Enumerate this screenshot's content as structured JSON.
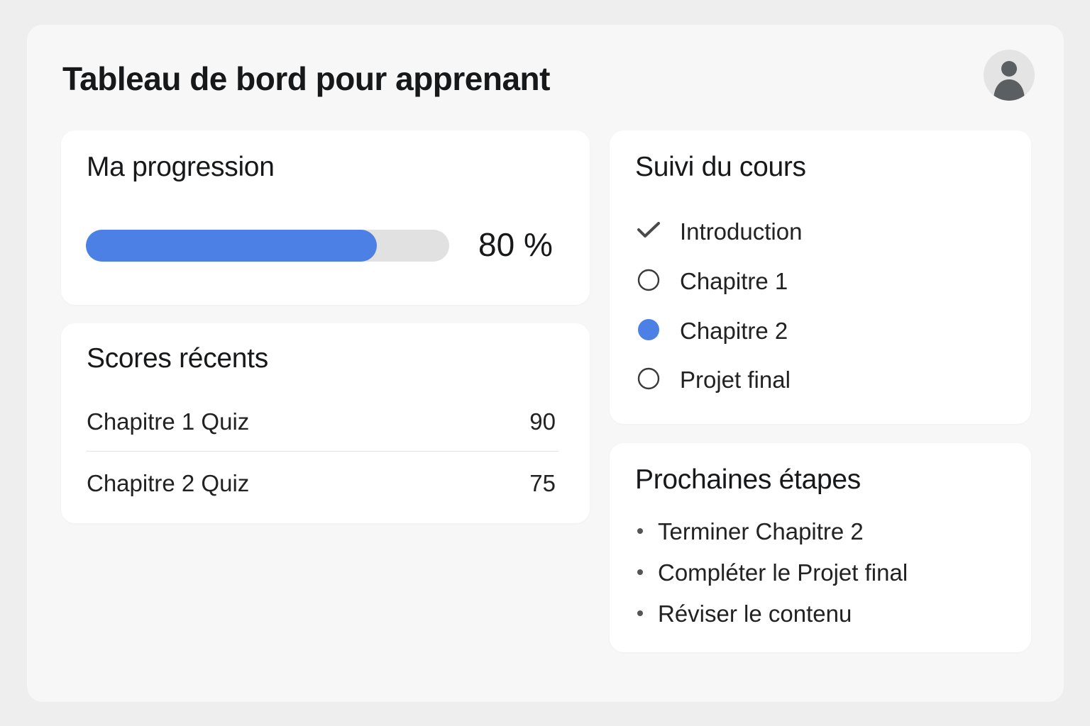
{
  "page": {
    "title": "Tableau de bord pour apprenant"
  },
  "user": {
    "avatar_icon": "user-avatar-icon"
  },
  "progress": {
    "title": "Ma progression",
    "value_fraction": 0.8,
    "value_label": "80 %",
    "fill_color": "#4c80e4"
  },
  "scores": {
    "title": "Scores récents",
    "rows": [
      {
        "name": "Chapitre 1 Quiz",
        "score": "90"
      },
      {
        "name": "Chapitre 2 Quiz",
        "score": "75"
      }
    ]
  },
  "course": {
    "title": "Suivi du cours",
    "items": [
      {
        "label": "Introduction",
        "status": "completed",
        "icon": "checkmark-icon"
      },
      {
        "label": "Chapitre 1",
        "status": "not-started",
        "icon": "empty-circle-icon"
      },
      {
        "label": "Chapitre 2",
        "status": "current",
        "icon": "filled-circle-icon"
      },
      {
        "label": "Projet final",
        "status": "not-started",
        "icon": "empty-circle-icon"
      }
    ],
    "current_color": "#4c80e4"
  },
  "next_steps": {
    "title": "Prochaines étapes",
    "items": [
      {
        "label": "Terminer Chapitre 2"
      },
      {
        "label": "Compléter le Projet final"
      },
      {
        "label": "Réviser le contenu"
      }
    ]
  }
}
